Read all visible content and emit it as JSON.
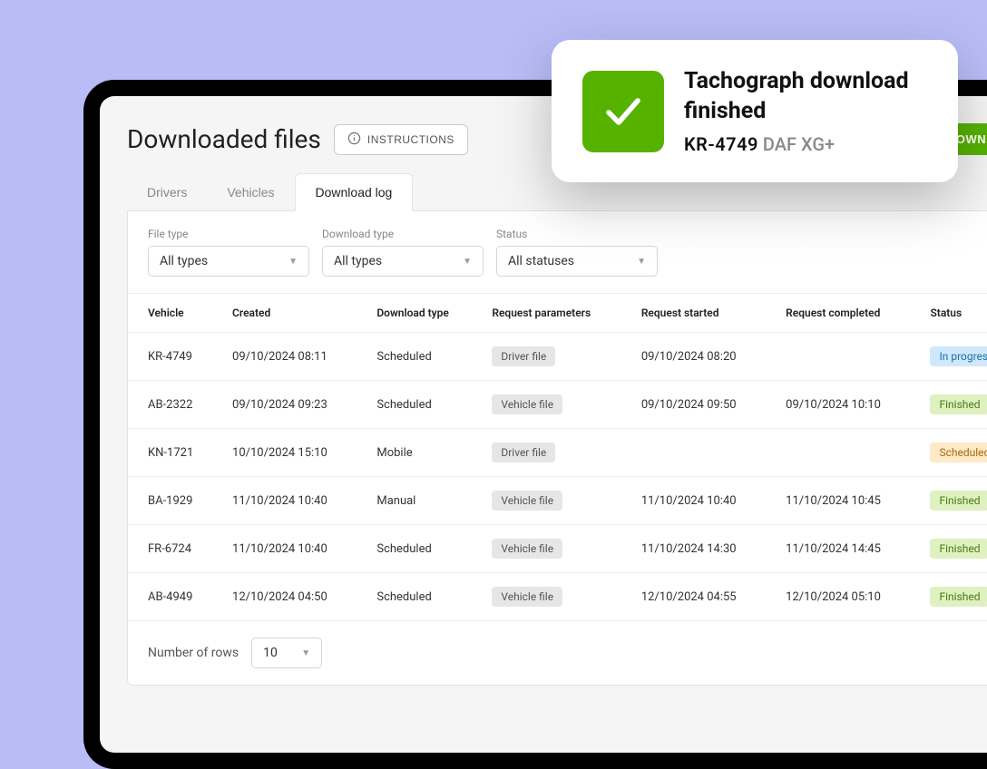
{
  "page": {
    "title": "Downloaded files",
    "instructions_label": "INSTRUCTIONS",
    "download_button": "+ DOWNLOAD"
  },
  "tabs": [
    {
      "label": "Drivers",
      "active": false
    },
    {
      "label": "Vehicles",
      "active": false
    },
    {
      "label": "Download log",
      "active": true
    }
  ],
  "filters": {
    "file_type": {
      "label": "File type",
      "value": "All types"
    },
    "download_type": {
      "label": "Download type",
      "value": "All types"
    },
    "status": {
      "label": "Status",
      "value": "All statuses"
    }
  },
  "table": {
    "columns": [
      "Vehicle",
      "Created",
      "Download type",
      "Request parameters",
      "Request started",
      "Request completed",
      "Status"
    ],
    "rows": [
      {
        "vehicle": "KR-4749",
        "created": "09/10/2024 08:11",
        "download_type": "Scheduled",
        "params": "Driver file",
        "started": "09/10/2024 08:20",
        "completed": "",
        "status": "In progress",
        "status_kind": "progress"
      },
      {
        "vehicle": "AB-2322",
        "created": "09/10/2024 09:23",
        "download_type": "Scheduled",
        "params": "Vehicle file",
        "started": "09/10/2024 09:50",
        "completed": "09/10/2024 10:10",
        "status": "Finished",
        "status_kind": "finished"
      },
      {
        "vehicle": "KN-1721",
        "created": "10/10/2024 15:10",
        "download_type": "Mobile",
        "params": "Driver file",
        "started": "",
        "completed": "",
        "status": "Scheduled",
        "status_kind": "scheduled"
      },
      {
        "vehicle": "BA-1929",
        "created": "11/10/2024 10:40",
        "download_type": "Manual",
        "params": "Vehicle file",
        "started": "11/10/2024 10:40",
        "completed": "11/10/2024 10:45",
        "status": "Finished",
        "status_kind": "finished"
      },
      {
        "vehicle": "FR-6724",
        "created": "11/10/2024 10:40",
        "download_type": "Scheduled",
        "params": "Vehicle file",
        "started": "11/10/2024 14:30",
        "completed": "11/10/2024 14:45",
        "status": "Finished",
        "status_kind": "finished"
      },
      {
        "vehicle": "AB-4949",
        "created": "12/10/2024 04:50",
        "download_type": "Scheduled",
        "params": "Vehicle file",
        "started": "12/10/2024 04:55",
        "completed": "12/10/2024 05:10",
        "status": "Finished",
        "status_kind": "finished"
      }
    ]
  },
  "pagination": {
    "label": "Number of rows",
    "value": "10"
  },
  "notification": {
    "title": "Tachograph download finished",
    "plate": "KR-4749",
    "model": "DAF XG+"
  }
}
